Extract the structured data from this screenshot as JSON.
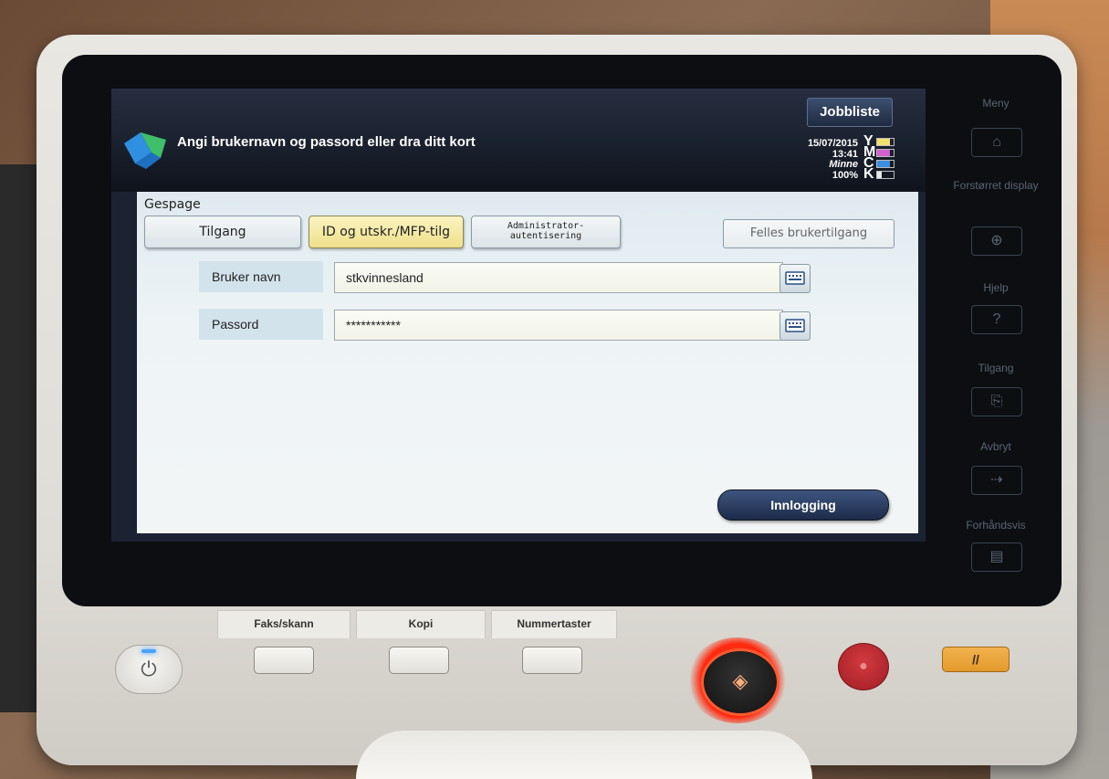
{
  "header": {
    "job_list_label": "Jobbliste",
    "message": "Angi brukernavn og passord eller dra ditt kort",
    "date": "15/07/2015",
    "time": "13:41",
    "memory_label": "Minne",
    "memory_value": "100%"
  },
  "toner": [
    {
      "letter": "Y",
      "color": "#f0e070",
      "level": 0.8
    },
    {
      "letter": "M",
      "color": "#d35fd0",
      "level": 0.8
    },
    {
      "letter": "C",
      "color": "#3a8de0",
      "level": 0.8
    },
    {
      "letter": "K",
      "color": "#e8e8e8",
      "level": 0.3
    }
  ],
  "auth": {
    "realm_label": "Gespage",
    "tabs": [
      {
        "label": "Tilgang",
        "active": false
      },
      {
        "label": "ID og utskr./MFP-tilg",
        "active": true
      },
      {
        "label": "Administrator-\nautentisering",
        "active": false
      }
    ],
    "shared_access_label": "Felles brukertilgang",
    "username_label": "Bruker navn",
    "username_value": "stkvinnesland",
    "password_label": "Passord",
    "password_value": "***********",
    "login_label": "Innlogging"
  },
  "side_keys": {
    "menu_label": "Meny",
    "enlarge_label": "Forstørret display",
    "help_label": "Hjelp",
    "help_icon_text": "?",
    "access_label": "Tilgang",
    "cancel_label": "Avbryt",
    "preview_label": "Forhåndsvis"
  },
  "hardware_tabs": {
    "fax_scan_label": "Faks/skann",
    "copy_label": "Kopi",
    "numkeys_label": "Nummertaster"
  },
  "colors": {
    "accent_active_tab": "#efe08a",
    "login_button": "#1c2a48",
    "start_glow": "#ff2a10",
    "stop_button": "#a11c24",
    "reset_button": "#e39a2c"
  }
}
